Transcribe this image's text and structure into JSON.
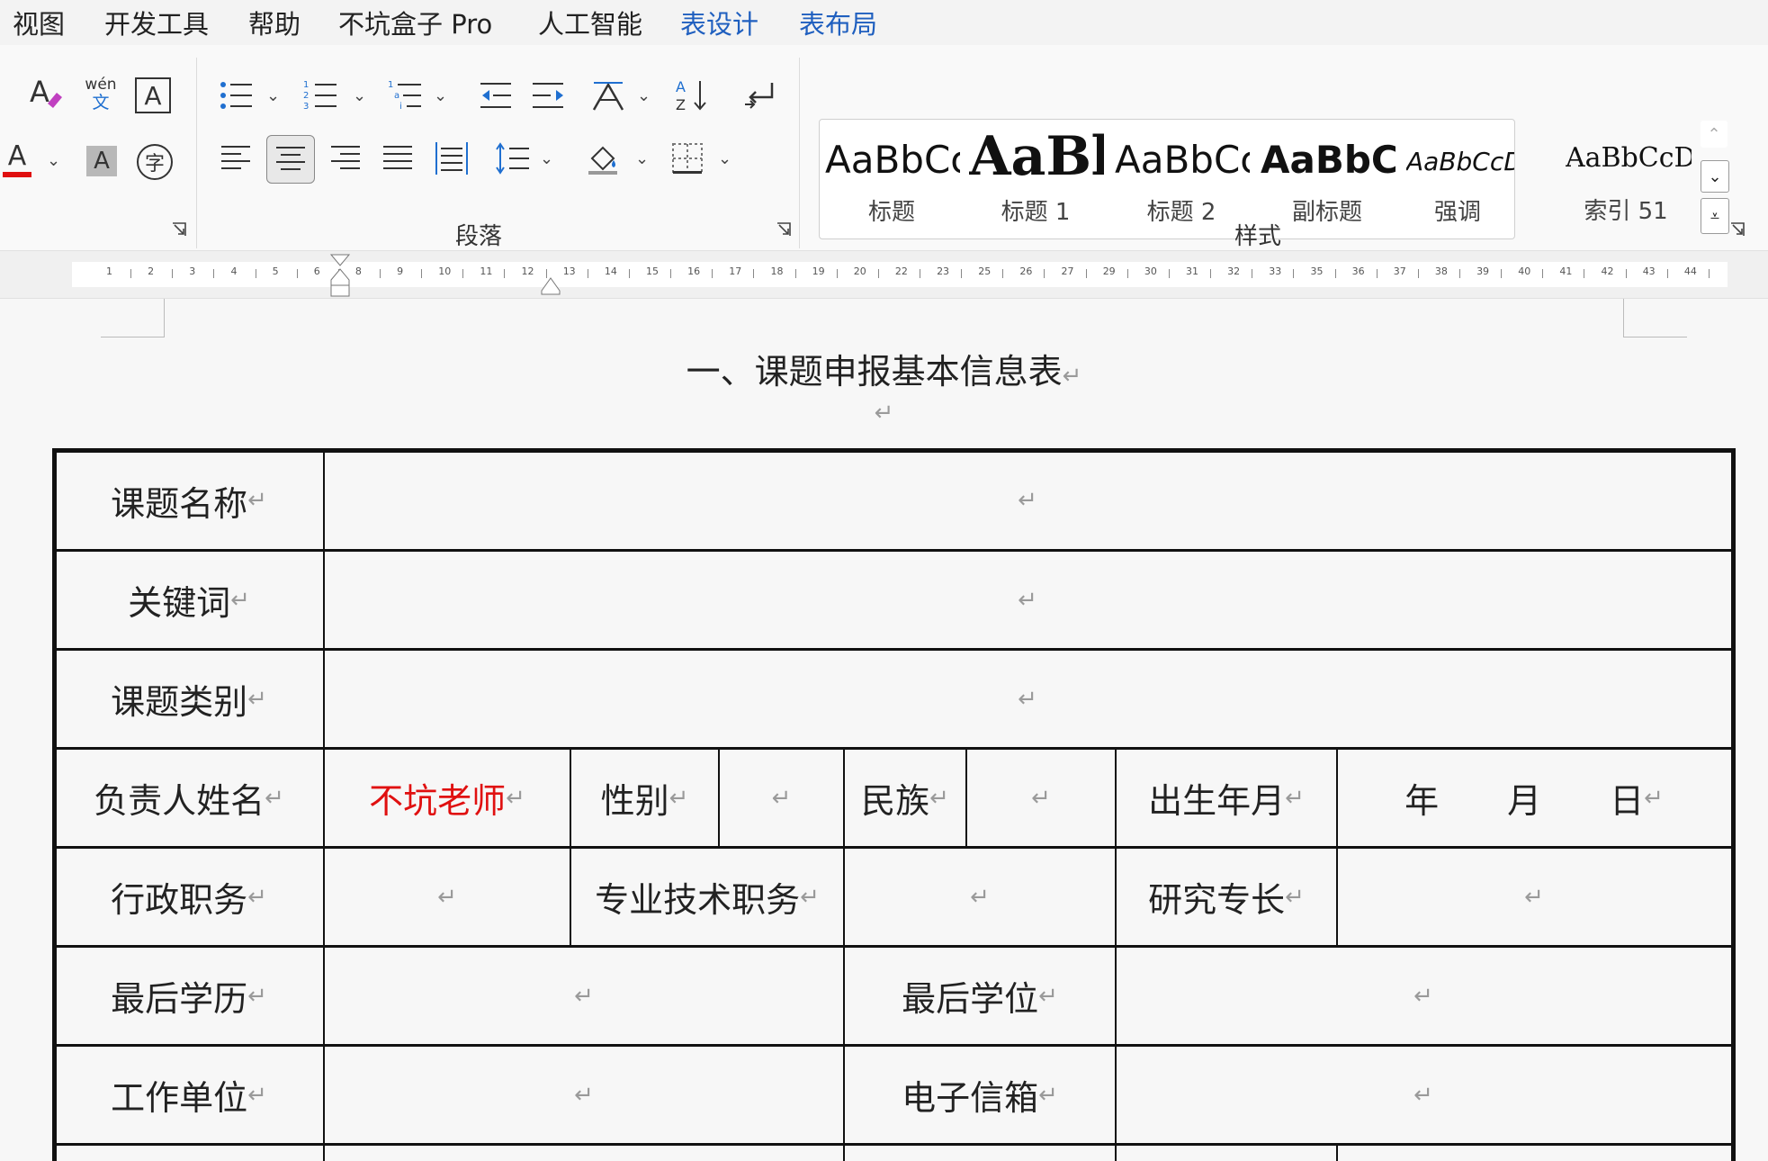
{
  "menu": {
    "tabs": [
      {
        "label": "视图",
        "contextual": false
      },
      {
        "label": "开发工具",
        "contextual": false
      },
      {
        "label": "帮助",
        "contextual": false
      },
      {
        "label": "不坑盒子 Pro",
        "contextual": false
      },
      {
        "label": "人工智能",
        "contextual": false
      },
      {
        "label": "表设计",
        "contextual": true
      },
      {
        "label": "表布局",
        "contextual": true
      }
    ]
  },
  "ribbon": {
    "font_group": {
      "phonetic_top": "wén",
      "phonetic_bottom": "文",
      "char_border": "A",
      "font_color_letter": "A",
      "shading_letter": "A",
      "enclose_char": "字"
    },
    "paragraph_group": {
      "label": "段落"
    },
    "styles_group": {
      "label": "样式",
      "items": [
        {
          "sample": "AaBbCcDd",
          "name": "标题"
        },
        {
          "sample": "AaBb",
          "name": "标题 1"
        },
        {
          "sample": "AaBbCcD",
          "name": "标题 2"
        },
        {
          "sample": "AaBbCcD",
          "name": "副标题"
        },
        {
          "sample": "AaBbCcDdE",
          "name": "强调"
        },
        {
          "sample": "AaBbCcDd",
          "name": "索引 51"
        }
      ]
    }
  },
  "ruler": {
    "numbers": [
      "1",
      "2",
      "3",
      "4",
      "5",
      "6",
      "8",
      "9",
      "10",
      "11",
      "12",
      "13",
      "14",
      "15",
      "16",
      "17",
      "18",
      "19",
      "20",
      "22",
      "23",
      "25",
      "26",
      "27",
      "29",
      "30",
      "31",
      "32",
      "33",
      "35",
      "36",
      "37",
      "38",
      "39",
      "40",
      "41",
      "42",
      "43",
      "44"
    ]
  },
  "document": {
    "title": "一、课题申报基本信息表",
    "para_mark": "↵",
    "rows": [
      {
        "label": "课题名称",
        "cells": [
          ""
        ]
      },
      {
        "label": "关键词",
        "cells": [
          ""
        ]
      },
      {
        "label": "课题类别",
        "cells": [
          ""
        ]
      },
      {
        "label": "负责人姓名",
        "name_value": "不坑老师",
        "gender_label": "性别",
        "gender_value": "",
        "ethnic_label": "民族",
        "ethnic_value": "",
        "birth_label": "出生年月",
        "birth_value": "年　　月　　日"
      },
      {
        "label": "行政职务",
        "admin_value": "",
        "tech_label": "专业技术职务",
        "tech_value": "",
        "research_label": "研究专长",
        "research_value": ""
      },
      {
        "label": "最后学历",
        "education_value": "",
        "degree_label": "最后学位",
        "degree_value": ""
      },
      {
        "label": "工作单位",
        "work_value": "",
        "email_label": "电子信箱",
        "email_value": ""
      }
    ]
  },
  "colors": {
    "contextual_tab": "#1f5fbf",
    "highlight_name": "#e01010",
    "font_color_bar": "#e01010"
  }
}
